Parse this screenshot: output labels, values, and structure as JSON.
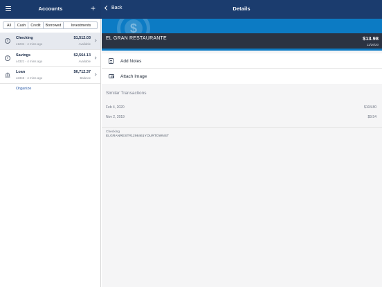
{
  "sidebar": {
    "title": "Accounts",
    "menu_icon": "hamburger-menu-icon",
    "add_icon": "plus-icon",
    "filters": [
      "All",
      "Cash",
      "Credit",
      "Borrowed",
      "Investments"
    ],
    "active_filter": "All",
    "accounts": [
      {
        "name": "Checking",
        "sub": "x1234 - 4 mins ago",
        "amount": "$1,512.03",
        "status": "Available",
        "icon": "info-circle-icon",
        "selected": true
      },
      {
        "name": "Savings",
        "sub": "x4321 - 4 mins ago",
        "amount": "$2,564.13",
        "status": "Available",
        "icon": "info-circle-icon",
        "selected": false
      },
      {
        "name": "Loan",
        "sub": "x2345 - 4 mins ago",
        "amount": "$6,712.37",
        "status": "Balance",
        "icon": "bank-icon",
        "selected": false
      }
    ],
    "organize_label": "Organize"
  },
  "detail": {
    "back_label": "Back",
    "title": "Details",
    "merchant": "EL GRAN RESTAURANTE",
    "amount": "$13.98",
    "date": "11/26/20",
    "actions": [
      {
        "label": "Add Notes",
        "icon": "notes-icon"
      },
      {
        "label": "Attach Image",
        "icon": "camera-icon"
      }
    ],
    "similar_header": "Similar Transactions",
    "similar": [
      {
        "date": "Feb 4, 2020",
        "amount": "$104.80"
      },
      {
        "date": "Nov 2, 2019",
        "amount": "$9.54"
      }
    ],
    "memo_account": "Checking",
    "memo_description": "ELGRANREST#1298461YOURTOWNST"
  },
  "colors": {
    "nav_bar": "#1a3a6b",
    "hero_blue": "#0c7bc4",
    "hero_band": "#2b3342",
    "link": "#2a5aa8"
  }
}
